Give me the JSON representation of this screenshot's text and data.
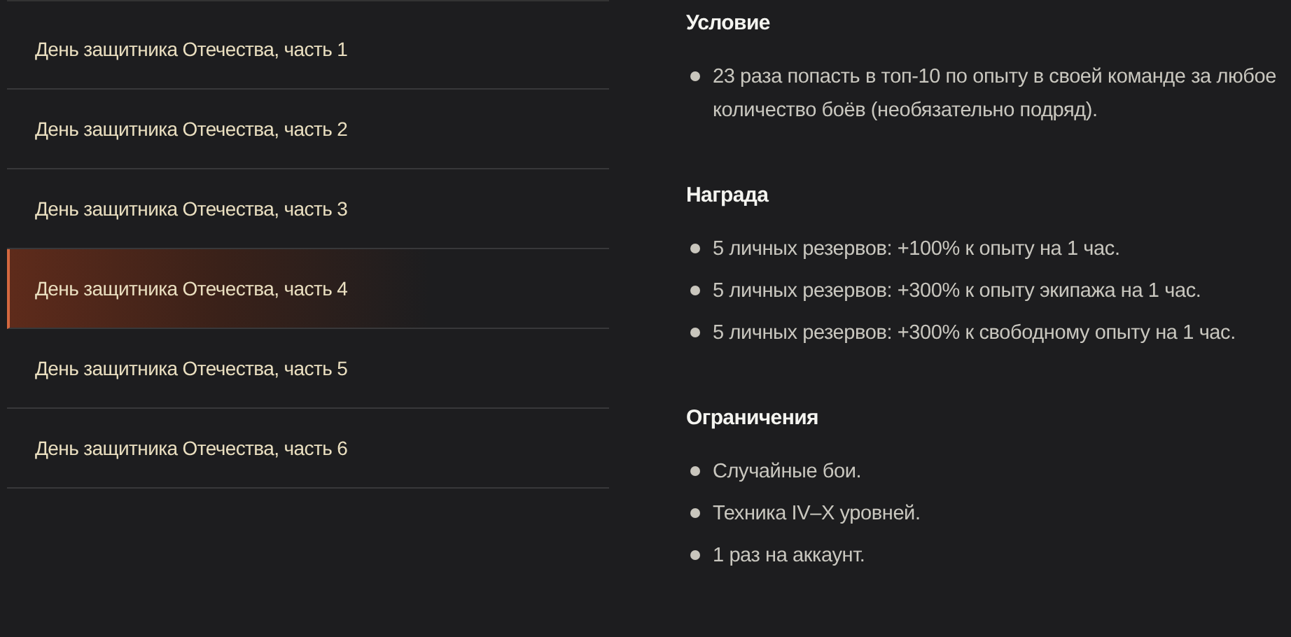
{
  "nav": [
    {
      "label": "День защитника Отечества, часть 1",
      "selected": false
    },
    {
      "label": "День защитника Отечества, часть 2",
      "selected": false
    },
    {
      "label": "День защитника Отечества, часть 3",
      "selected": false
    },
    {
      "label": "День защитника Отечества, часть 4",
      "selected": true
    },
    {
      "label": "День защитника Отечества, часть 5",
      "selected": false
    },
    {
      "label": "День защитника Отечества, часть 6",
      "selected": false
    }
  ],
  "sections": [
    {
      "heading": "Условие",
      "items": [
        "23 раза попасть в топ-10 по опыту в своей команде за любое количество боёв (необязательно подряд)."
      ]
    },
    {
      "heading": "Награда",
      "items": [
        "5 личных резервов: +100% к опыту на 1 час.",
        "5 личных резервов: +300% к опыту экипажа на 1 час.",
        "5 личных резервов: +300% к свободному опыту на 1 час."
      ]
    },
    {
      "heading": "Ограничения",
      "items": [
        "Случайные бои.",
        "Техника IV–X уровней.",
        "1 раз на аккаунт."
      ]
    }
  ]
}
